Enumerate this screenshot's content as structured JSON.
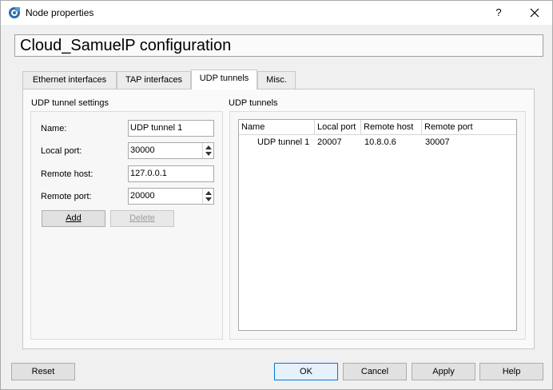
{
  "window": {
    "title": "Node properties",
    "help_glyph": "?"
  },
  "header": {
    "title": "Cloud_SamuelP configuration"
  },
  "tabs": [
    {
      "label": "Ethernet interfaces",
      "active": false
    },
    {
      "label": "TAP interfaces",
      "active": false
    },
    {
      "label": "UDP tunnels",
      "active": true
    },
    {
      "label": "Misc.",
      "active": false
    }
  ],
  "settings": {
    "group_title": "UDP tunnel settings",
    "name_label": "Name:",
    "name_value": "UDP tunnel 1",
    "local_port_label": "Local port:",
    "local_port_value": "30000",
    "remote_host_label": "Remote host:",
    "remote_host_value": "127.0.0.1",
    "remote_port_label": "Remote port:",
    "remote_port_value": "20000",
    "add_label": "Add",
    "delete_label": "Delete"
  },
  "tunnels": {
    "group_title": "UDP tunnels",
    "columns": [
      "Name",
      "Local port",
      "Remote host",
      "Remote port"
    ],
    "rows": [
      [
        "UDP tunnel 1",
        "20007",
        "10.8.0.6",
        "30007"
      ]
    ]
  },
  "footer": {
    "reset_label": "Reset",
    "ok_label": "OK",
    "cancel_label": "Cancel",
    "apply_label": "Apply",
    "help_label": "Help"
  },
  "colors": {
    "focus_border": "#0078d7",
    "app_icon": "#2b6cb0"
  }
}
